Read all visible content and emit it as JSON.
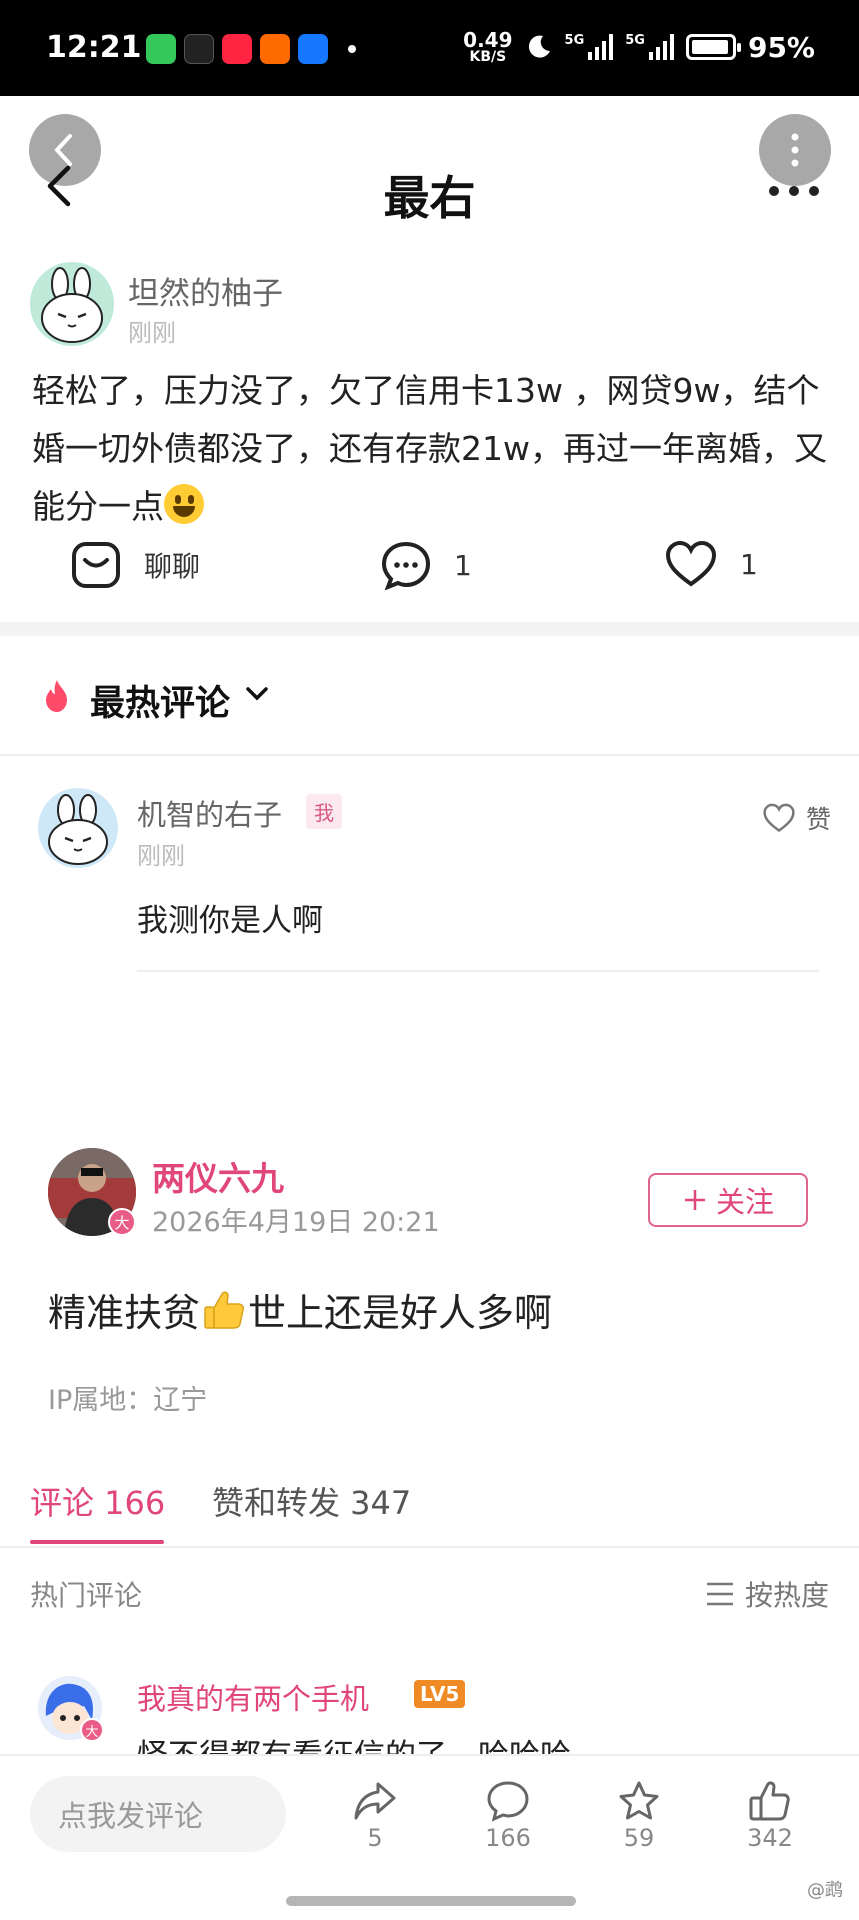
{
  "status_bar": {
    "time": "12:21",
    "net_speed_value": "0.49",
    "net_speed_unit": "KB/S",
    "sig1": "5G",
    "sig2": "5G",
    "battery": "95%"
  },
  "header": {
    "title": "最右"
  },
  "post": {
    "user": "坦然的柚子",
    "time": "刚刚",
    "body": "轻松了，压力没了，欠了信用卡13w ，网贷9w，结个婚一切外债都没了，还有存款21w，再过一年离婚，又能分一点",
    "chat_label": "聊聊",
    "comment_count": "1",
    "like_count": "1"
  },
  "hot_comments": {
    "title": "最热评论",
    "items": [
      {
        "user": "机智的右子",
        "tag": "我",
        "time": "刚刚",
        "text": "我测你是人啊",
        "like_label": "赞"
      }
    ]
  },
  "repost": {
    "user": "两仪六九",
    "badge": "大",
    "time": "2026年4月19日 20:21",
    "follow_label": "关注",
    "text_before": "精准扶贫",
    "text_after": "世上还是好人多啊",
    "ip": "IP属地：辽宁",
    "tabs": [
      {
        "label": "评论 166",
        "active": true
      },
      {
        "label": "赞和转发 347",
        "active": false
      }
    ],
    "hot_label": "热门评论",
    "sort_label": "按热度",
    "comments": [
      {
        "user": "我真的有两个手机",
        "level": "LV5",
        "badge": "大",
        "text": "怪不得都有看征信的了，哈哈哈"
      }
    ]
  },
  "bottom_bar": {
    "input_placeholder": "点我发评论",
    "share_count": "5",
    "comment_count": "166",
    "star_count": "59",
    "like_count": "342",
    "corner_text": "@鹉"
  },
  "colors": {
    "accent": "#e0457b",
    "orange": "#f08a24",
    "text": "#222222",
    "muted": "#999999"
  }
}
